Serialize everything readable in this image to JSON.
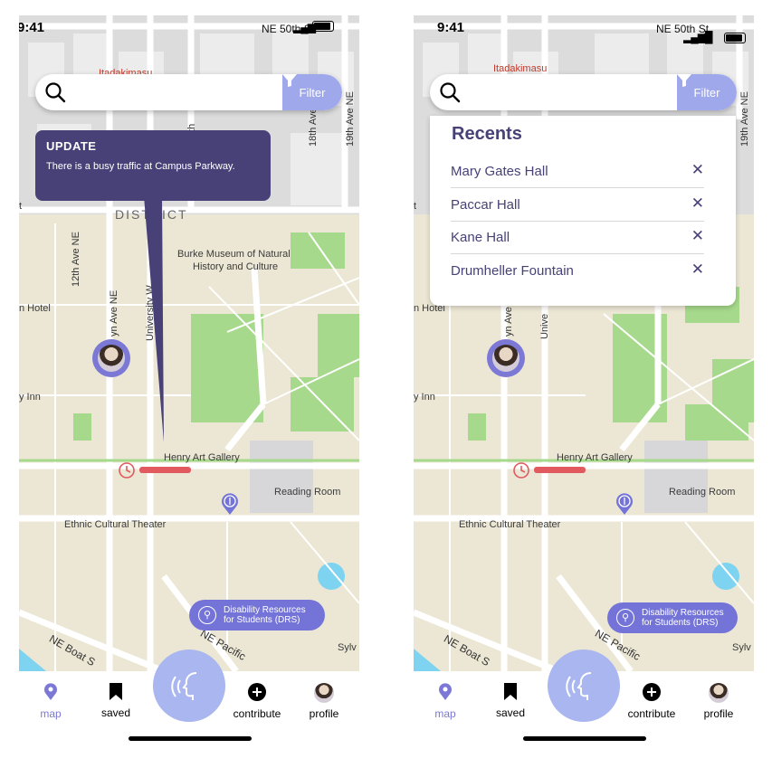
{
  "status": {
    "time": "9:41",
    "time_left": "9:41",
    "street": "NE 50th St"
  },
  "search": {
    "placeholder": "",
    "filter_label": "Filter"
  },
  "update": {
    "title": "UPDATE",
    "message": "There is a busy traffic at Campus Parkway."
  },
  "recents": {
    "title": "Recents",
    "items": [
      {
        "label": "Mary Gates Hall",
        "remove": "✕"
      },
      {
        "label": "Paccar Hall",
        "remove": "✕"
      },
      {
        "label": "Kane Hall",
        "remove": "✕"
      },
      {
        "label": "Drumheller Fountain",
        "remove": "✕"
      }
    ]
  },
  "map_labels": {
    "itadakimasu": "Itadakimasu",
    "district": "DISTRICT",
    "burke": "Burke Museum of Natural",
    "burke2": "History and Culture",
    "henry": "Henry Art Gallery",
    "reading": "Reading Room",
    "ethnic": "Ethnic Cultural Theater",
    "hotel": "n Hotel",
    "inn": "y Inn",
    "twelfth": "12th Ave NE",
    "brooklyn": "yn Ave NE",
    "university": "University W",
    "univ_short": "Unive",
    "eighteenth": "18th Ave NE",
    "nineteenth": "19th Ave NE",
    "fifteenth": "5th",
    "boat": "NE Boat S",
    "pacific": "NE Pacific",
    "sylv": "Sylv",
    "t": "t"
  },
  "drs": {
    "label_line1": "Disability Resources",
    "label_line2": "for Students (DRS)"
  },
  "nav": {
    "map": "map",
    "saved": "saved",
    "contribute": "contribute",
    "profile": "profile"
  },
  "colors": {
    "accent": "#474178",
    "filter": "#9ea8ea",
    "voice": "#a9b6f0",
    "nav_active": "#7b78d6",
    "traffic": "#e05a5f",
    "map_land": "#ece7d4",
    "map_park": "#a6d98b"
  }
}
